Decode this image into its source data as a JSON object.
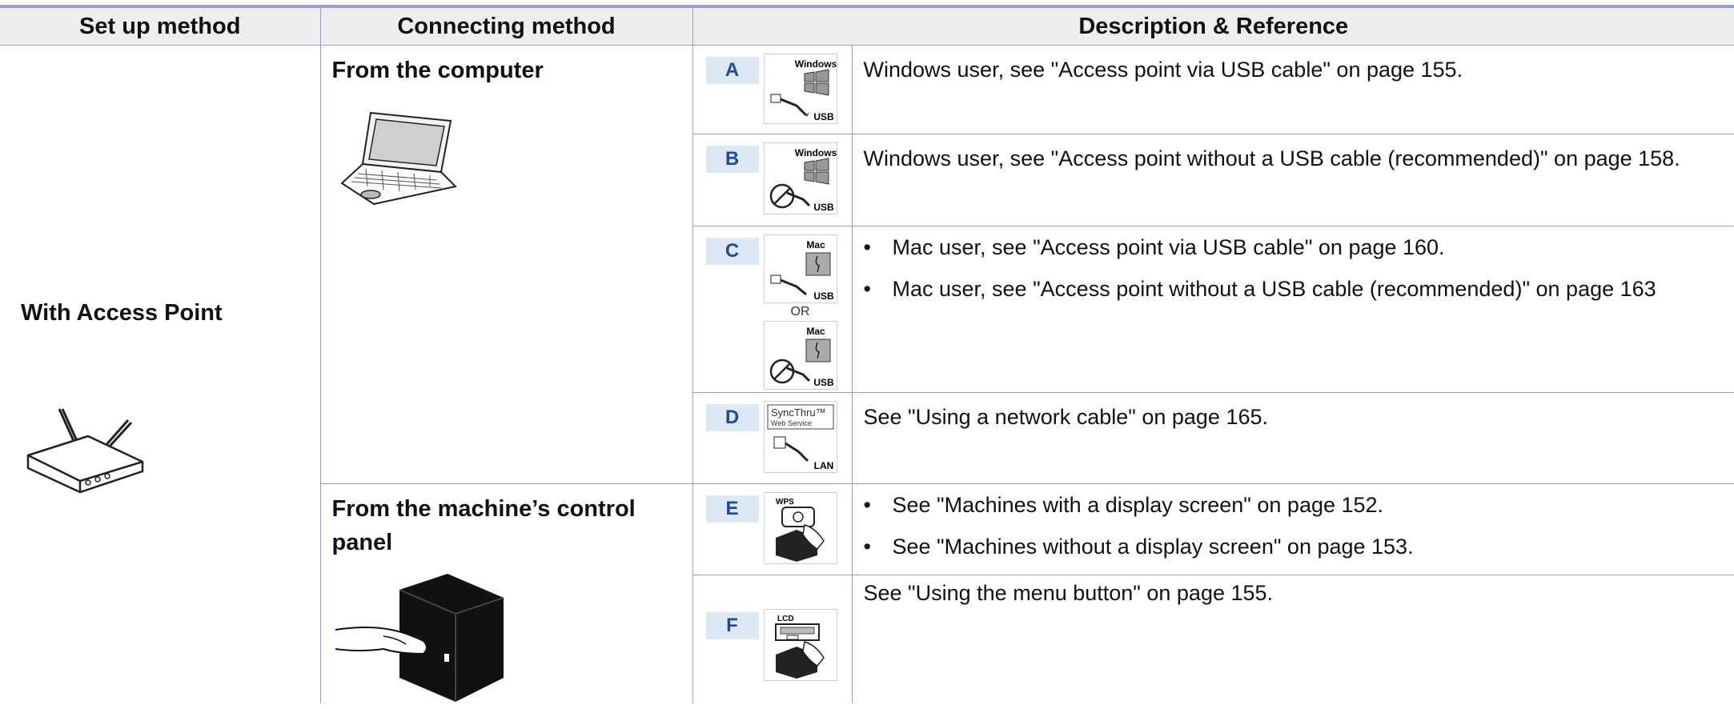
{
  "header": {
    "col1": "Set up method",
    "col2": "Connecting method",
    "col3": "Description & Reference"
  },
  "setup": {
    "label": "With Access Point",
    "icon": "wireless-router-icon"
  },
  "connecting": {
    "computer": {
      "label": "From the computer",
      "icon": "laptop-icon"
    },
    "panel": {
      "label": "From the machine’s control panel",
      "icon": "printer-hand-icon"
    }
  },
  "rows": [
    {
      "letter": "A",
      "thumb": {
        "top": "Windows",
        "bottom": "USB"
      },
      "text": "Windows user, see \"Access point via USB cable\" on page 155."
    },
    {
      "letter": "B",
      "thumb": {
        "top": "Windows",
        "bottom": "USB"
      },
      "text": "Windows user, see \"Access point without a USB cable (recommended)\" on page 158."
    },
    {
      "letter": "C",
      "thumb": {
        "top": "Mac",
        "bottom": "USB",
        "or": "OR",
        "top2": "Mac",
        "bottom2": "USB"
      },
      "bullets": [
        "Mac user, see \"Access point via USB cable\" on page 160.",
        "Mac user, see \"Access point without a USB cable (recommended)\" on page 163"
      ]
    },
    {
      "letter": "D",
      "thumb": {
        "top": "SyncThru™",
        "sub": "Web Service",
        "bottom": "LAN"
      },
      "text": "See \"Using a network cable\" on page 165."
    },
    {
      "letter": "E",
      "thumb": {
        "top": "WPS"
      },
      "bullets": [
        "See \"Machines with a display screen\" on page 152.",
        "See \"Machines without a display screen\" on page 153."
      ]
    },
    {
      "letter": "F",
      "thumb": {
        "top": "LCD"
      },
      "text": "See \"Using the menu button\" on page 155."
    }
  ],
  "colors": {
    "rule": "#9b9bd4",
    "header_bg": "#eeeeee",
    "letter_bg": "#dde8f5",
    "letter_text": "#1e4a9e"
  }
}
